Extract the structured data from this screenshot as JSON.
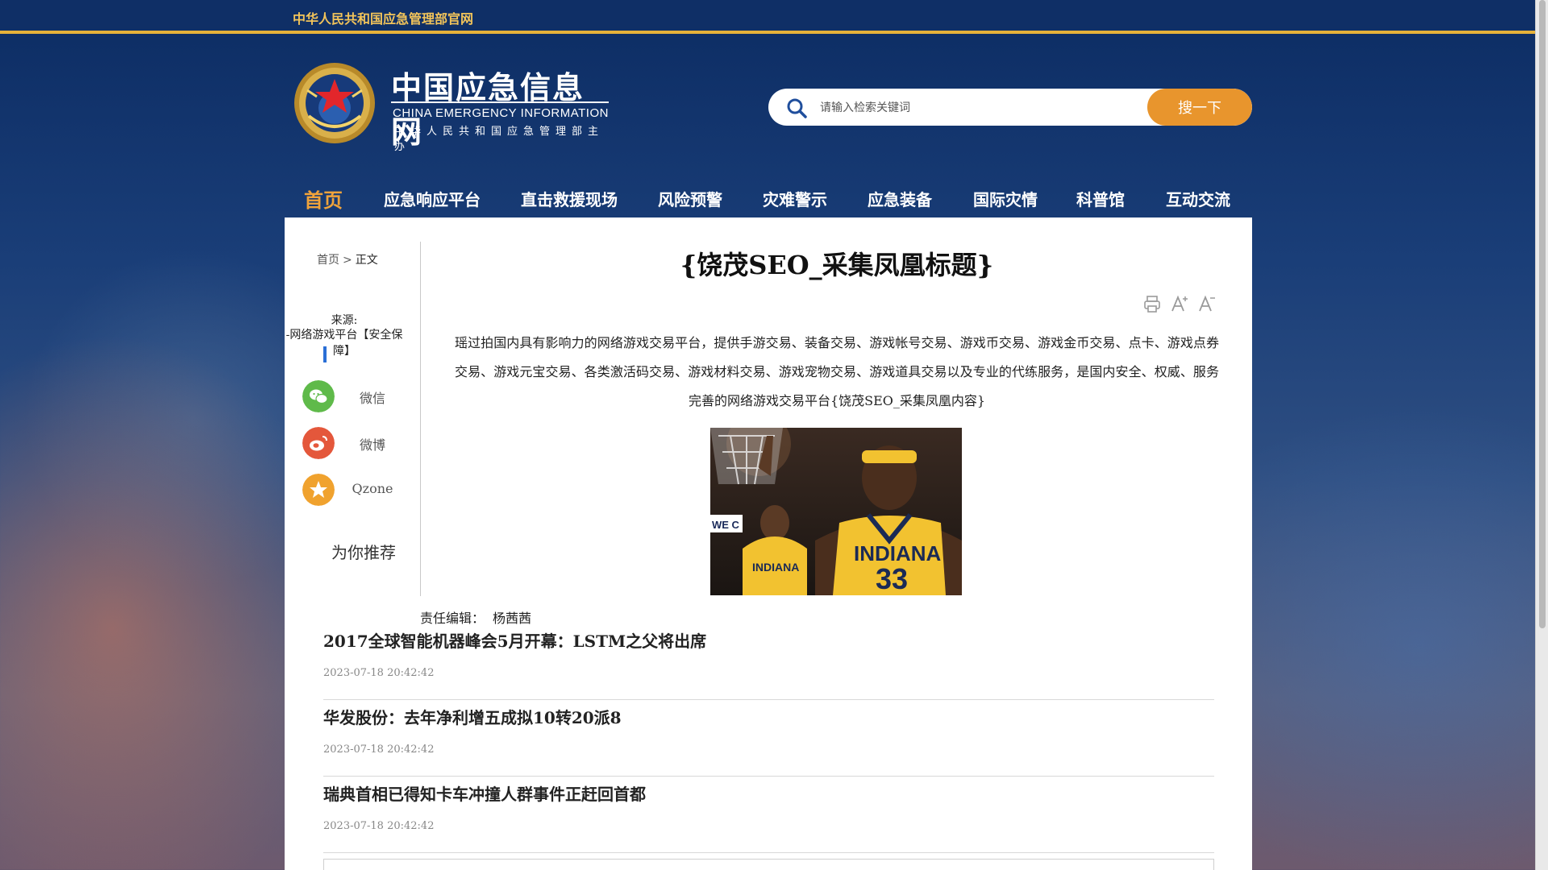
{
  "topbar": {
    "site_name": "中华人民共和国应急管理部官网"
  },
  "logo": {
    "title_zh": "中国应急信息网",
    "title_en": "CHINA EMERGENCY INFORMATION",
    "subtitle": "中华人民共和国应急管理部主办"
  },
  "search": {
    "placeholder": "请输入检索关键词",
    "button_label": "搜一下",
    "icon": "search-icon"
  },
  "nav": {
    "items": [
      {
        "label": "首页",
        "active": true
      },
      {
        "label": "应急响应平台"
      },
      {
        "label": "直击救援现场"
      },
      {
        "label": "风险预警"
      },
      {
        "label": "灾难警示"
      },
      {
        "label": "应急装备"
      },
      {
        "label": "国际灾情"
      },
      {
        "label": "科普馆"
      },
      {
        "label": "互动交流"
      }
    ]
  },
  "breadcrumb": {
    "home": "首页",
    "separator": ">",
    "current": "正文"
  },
  "source": {
    "label": "来源:",
    "value": "-网络游戏平台【安全保障】"
  },
  "share": [
    {
      "label": "微信",
      "icon": "wechat-icon",
      "color": "#5fba4a"
    },
    {
      "label": "微博",
      "icon": "weibo-icon",
      "color": "#e4573b"
    },
    {
      "label": "Qzone",
      "icon": "qzone-icon",
      "color": "#f0a22e"
    }
  ],
  "recommend_label": "为你推荐",
  "article": {
    "title": "{饶茂SEO_采集凤凰标题}",
    "tools": [
      "print-icon",
      "font-increase-icon",
      "font-decrease-icon"
    ],
    "body": "瑶过拍国内具有影响力的网络游戏交易平台，提供手游交易、装备交易、游戏帐号交易、游戏币交易、游戏金币交易、点卡、游戏点券交易、游戏元宝交易、各类激活码交易、游戏材料交易、游戏宠物交易、游戏道具交易以及专业的代练服务，是国内安全、权威、服务完善的网络游戏交易平台{饶茂SEO_采集凤凰内容}",
    "image_alt": "basketball-player-photo",
    "image_text": {
      "jersey_team": "INDIANA",
      "jersey_number": "33",
      "banner_fragment": "WE C"
    },
    "editor_label": "责任编辑：",
    "editor_name": "杨茜茜"
  },
  "news": [
    {
      "title": "2017全球智能机器峰会5月开幕：LSTM之父将出席",
      "date": "2023-07-18 20:42:42"
    },
    {
      "title": "华发股份：去年净利增五成拟10转20派8",
      "date": "2023-07-18 20:42:42"
    },
    {
      "title": "瑞典首相已得知卡车冲撞人群事件正赶回首都",
      "date": "2023-07-18 20:42:42"
    }
  ],
  "colors": {
    "topbar_bg": "#0f2f66",
    "accent_gold": "#e6b13a",
    "nav_active": "#f0a33b",
    "search_button": "#e8952d"
  }
}
